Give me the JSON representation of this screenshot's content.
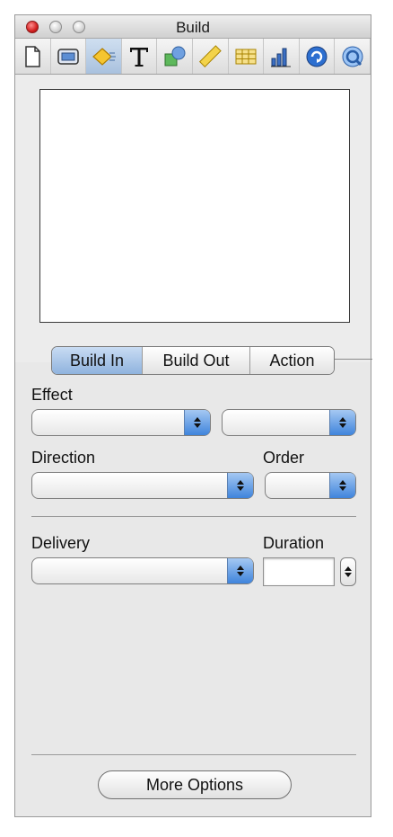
{
  "window": {
    "title": "Build"
  },
  "toolbar": {
    "icons": [
      "document-icon",
      "slide-icon",
      "build-icon",
      "text-icon",
      "shapes-icon",
      "ruler-icon",
      "table-icon",
      "chart-icon",
      "hyperlink-icon",
      "quicktime-icon"
    ],
    "active": "build-icon"
  },
  "tabs": [
    {
      "label": "Build In",
      "selected": true
    },
    {
      "label": "Build Out",
      "selected": false
    },
    {
      "label": "Action",
      "selected": false
    }
  ],
  "effect": {
    "label": "Effect",
    "value": "",
    "secondary_value": ""
  },
  "direction": {
    "label": "Direction",
    "value": ""
  },
  "order": {
    "label": "Order",
    "value": ""
  },
  "delivery": {
    "label": "Delivery",
    "value": ""
  },
  "duration": {
    "label": "Duration",
    "value": ""
  },
  "more_options": {
    "label": "More Options"
  },
  "colors": {
    "accent": "#3f84dc",
    "active_tool": "#a9c1de",
    "close": "#d21f1f"
  }
}
